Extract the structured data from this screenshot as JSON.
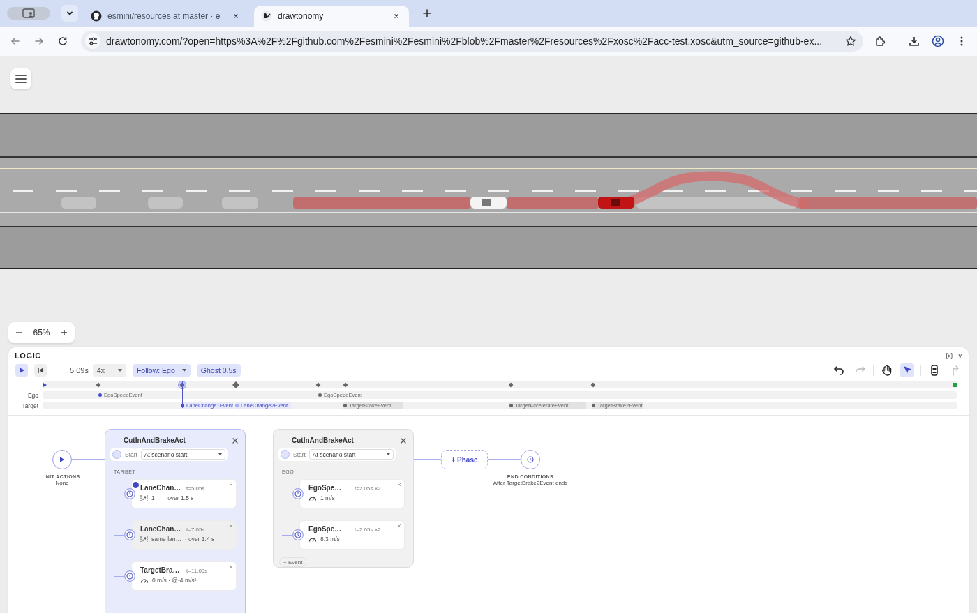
{
  "browser": {
    "tabs": [
      {
        "title": "esmini/resources at master · e",
        "kind": "github",
        "selected": false
      },
      {
        "title": "drawtonomy",
        "kind": "app",
        "selected": true
      }
    ],
    "address": "drawtonomy.com/?open=https%3A%2F%2Fgithub.com%2Fesmini%2Fesmini%2Fblob%2Fmaster%2Fresources%2Fxosc%2Facc-test.xosc&utm_source=github-ex..."
  },
  "zoom": {
    "value": "65%"
  },
  "logic": {
    "title": "LOGIC",
    "variables_label": "{x}",
    "collapse_label": "v",
    "time": "5.09s",
    "speed": "4x",
    "follow": "Follow: Ego",
    "ghost": {
      "label": "Ghost 0.5s",
      "on": true
    },
    "tools": [
      {
        "kind": "undo",
        "selected": false,
        "disabled": false
      },
      {
        "kind": "redo",
        "selected": false,
        "disabled": true
      },
      {
        "kind": "hand",
        "selected": false,
        "disabled": false
      },
      {
        "kind": "pointer",
        "selected": true,
        "disabled": false
      },
      {
        "kind": "vehicle",
        "selected": false,
        "disabled": false
      },
      {
        "kind": "path",
        "selected": false,
        "disabled": true
      }
    ],
    "timeline": {
      "level": 0.153,
      "tracks": [
        {
          "label": "Ego",
          "events": [
            {
              "name": "EgoSpeedEvent",
              "active": true,
              "current": false
            },
            {
              "name": "EgoSpeedEvent",
              "active": false,
              "current": false
            }
          ]
        },
        {
          "label": "Target",
          "events": [
            {
              "name": "LaneChange1Event",
              "active": true,
              "current": true
            },
            {
              "name": "LaneChange2Event",
              "active": false,
              "current": true
            },
            {
              "name": "TargetBrakeEvent",
              "active": false,
              "current": false
            },
            {
              "name": "TargetAccelerateEvent",
              "active": false,
              "current": false
            },
            {
              "name": "TargetBrake2Event",
              "active": false,
              "current": false
            }
          ]
        }
      ]
    },
    "init": {
      "label": "INIT ACTIONS",
      "value": "None"
    },
    "acts": [
      {
        "title": "CutInAndBrakeAct",
        "selected": true,
        "start_label": "Start",
        "start_value": "At scenario start",
        "group": "TARGET",
        "events": [
          {
            "name": "LaneChan…",
            "time": "t=5.05s",
            "kind": "lane_change",
            "detail": "1 ← · over 1.5 s",
            "active": true,
            "hovered": false
          },
          {
            "name": "LaneChan…",
            "time": "t=7.05s",
            "kind": "lane_change",
            "detail": "same lan…  · over 1.4 s",
            "active": false,
            "hovered": true
          },
          {
            "name": "TargetBra…",
            "time": "t=11.05s",
            "kind": "speed",
            "detail": "0 m/s · @-4 m/s²",
            "active": false,
            "hovered": false
          }
        ]
      },
      {
        "title": "CutInAndBrakeAct",
        "selected": false,
        "start_label": "Start",
        "start_value": "At scenario start",
        "group": "EGO",
        "add_event": "+ Event",
        "events": [
          {
            "name": "EgoSpe…",
            "time": "t=2.05s ×2",
            "kind": "speed",
            "detail": "1 m/s",
            "active": false,
            "hovered": false
          },
          {
            "name": "EgoSpe…",
            "time": "t=2.05s ×2",
            "kind": "speed",
            "detail": "8.3 m/s",
            "active": false,
            "hovered": false
          }
        ]
      }
    ],
    "add_phase": "+ Phase",
    "end": {
      "label": "END CONDITIONS",
      "value": "After TargetBrake2Event ends"
    }
  }
}
